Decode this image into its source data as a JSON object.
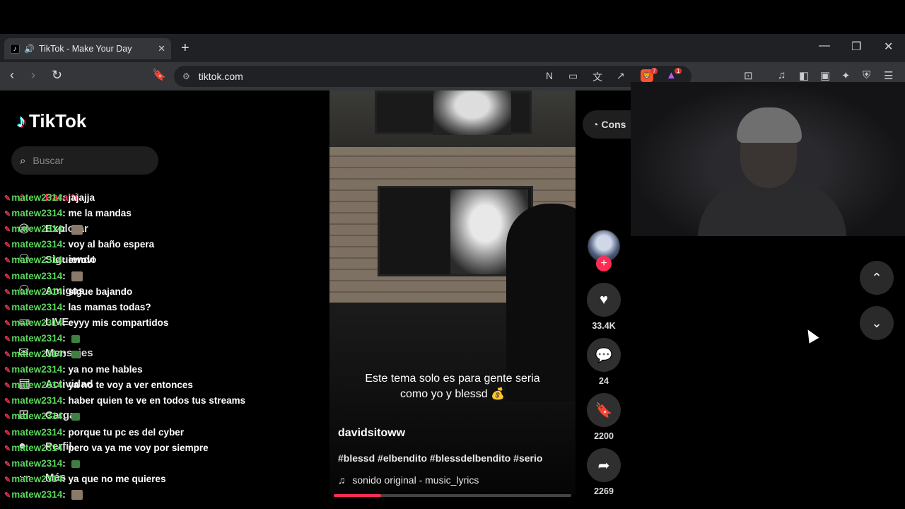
{
  "browser": {
    "tab_title": "TikTok - Make Your Day",
    "url": "tiktok.com",
    "new_tab": "+",
    "brave_badge": "7",
    "alert_badge": "1"
  },
  "sidebar": {
    "logo_text": "TikTok",
    "search_placeholder": "Buscar",
    "nav": [
      "Para ti",
      "Explorar",
      "Siguiendo",
      "Amigos",
      "LIVE",
      "Mensajes",
      "Actividad",
      "Cargar",
      "Perfil",
      "Más"
    ]
  },
  "chat": [
    {
      "user": "matew2314",
      "msg": "jajajja",
      "emote": ""
    },
    {
      "user": "matew2314",
      "msg": "me la mandas",
      "emote": ""
    },
    {
      "user": "matew2314",
      "msg": "",
      "emote": "face"
    },
    {
      "user": "matew2314",
      "msg": "voy al baño espera",
      "emote": ""
    },
    {
      "user": "matew2314",
      "msg": "ewovi",
      "emote": ""
    },
    {
      "user": "matew2314",
      "msg": "",
      "emote": "face"
    },
    {
      "user": "matew2314",
      "msg": "sigue bajando",
      "emote": ""
    },
    {
      "user": "matew2314",
      "msg": "las mamas todas?",
      "emote": ""
    },
    {
      "user": "matew2314",
      "msg": "eyyy mis compartidos",
      "emote": ""
    },
    {
      "user": "matew2314",
      "msg": "",
      "emote": "green"
    },
    {
      "user": "matew2314",
      "msg": "",
      "emote": "green"
    },
    {
      "user": "matew2314",
      "msg": "ya no me hables",
      "emote": ""
    },
    {
      "user": "matew2314",
      "msg": "ya no te voy a ver entonces",
      "emote": ""
    },
    {
      "user": "matew2314",
      "msg": "haber quien te ve en todos tus streams",
      "emote": ""
    },
    {
      "user": "matew2314",
      "msg": "",
      "emote": "green"
    },
    {
      "user": "matew2314",
      "msg": "porque tu pc es del cyber",
      "emote": ""
    },
    {
      "user": "matew2314",
      "msg": "pero va ya me voy por siempre",
      "emote": ""
    },
    {
      "user": "matew2314",
      "msg": "",
      "emote": "green"
    },
    {
      "user": "matew2314",
      "msg": "ya que no me quieres",
      "emote": ""
    },
    {
      "user": "matew2314",
      "msg": "",
      "emote": "face"
    }
  ],
  "video": {
    "caption": "Este tema solo es para gente seria como yo y blessd 💰",
    "author": "davidsitoww",
    "tags": "#blessd #elbendito #blessdelbendito #serio",
    "sound": "sonido original - music_lyrics",
    "progress": 0.2
  },
  "actions": {
    "likes": "33.4K",
    "comments": "24",
    "saves": "2200",
    "shares": "2269",
    "consult_label": "Cons"
  },
  "colors": {
    "accent": "#fe2c55",
    "chat_user": "#5cd65c"
  }
}
